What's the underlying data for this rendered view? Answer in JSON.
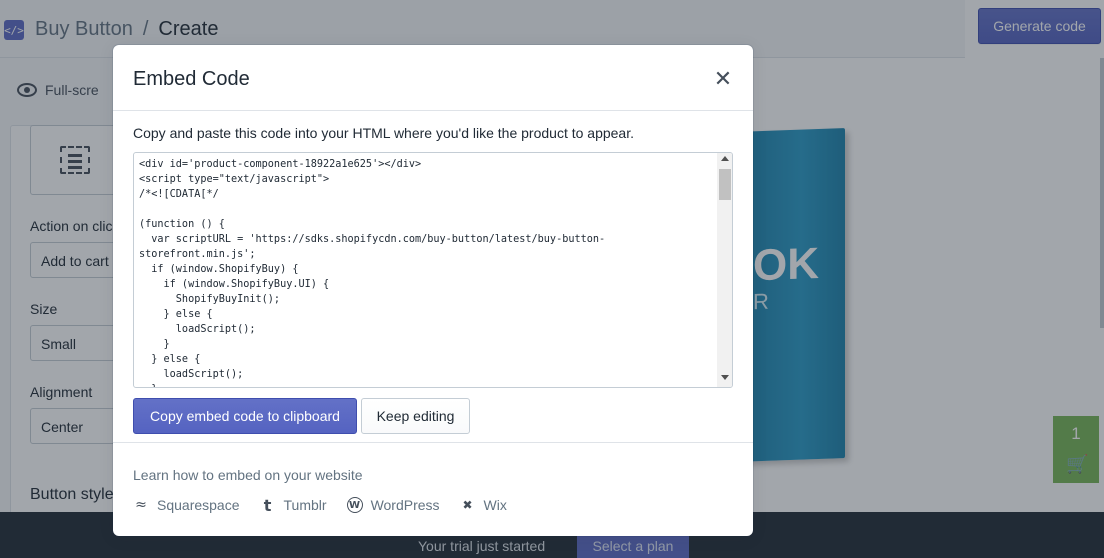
{
  "header": {
    "breadcrumb_parent": "Buy Button",
    "breadcrumb_separator": "/",
    "breadcrumb_current": "Create",
    "generate_button": "Generate code"
  },
  "sidebar": {
    "fullscreen_label": "Full-scre",
    "action_label": "Action on clic",
    "action_value": "Add to cart",
    "size_label": "Size",
    "size_value": "Small",
    "alignment_label": "Alignment",
    "alignment_value": "Center",
    "button_style_label": "Button style"
  },
  "preview": {
    "book_text_1": "OK",
    "book_text_2": "R",
    "cart_count": "1"
  },
  "footer": {
    "trial_text": "Your trial just started",
    "plan_button": "Select a plan"
  },
  "modal": {
    "title": "Embed Code",
    "close_symbol": "✕",
    "description": "Copy and paste this code into your HTML where you'd like the product to appear.",
    "code": "<div id='product-component-18922a1e625'></div>\n<script type=\"text/javascript\">\n/*<![CDATA[*/\n\n(function () {\n  var scriptURL = 'https://sdks.shopifycdn.com/buy-button/latest/buy-button-\nstorefront.min.js';\n  if (window.ShopifyBuy) {\n    if (window.ShopifyBuy.UI) {\n      ShopifyBuyInit();\n    } else {\n      loadScript();\n    }\n  } else {\n    loadScript();\n  }",
    "copy_button": "Copy embed code to clipboard",
    "keep_editing_button": "Keep editing",
    "learn_text": "Learn how to embed on your website",
    "platforms": [
      {
        "name": "Squarespace",
        "icon": "squarespace-icon"
      },
      {
        "name": "Tumblr",
        "icon": "tumblr-icon"
      },
      {
        "name": "WordPress",
        "icon": "wordpress-icon"
      },
      {
        "name": "Wix",
        "icon": "wix-icon"
      }
    ]
  }
}
